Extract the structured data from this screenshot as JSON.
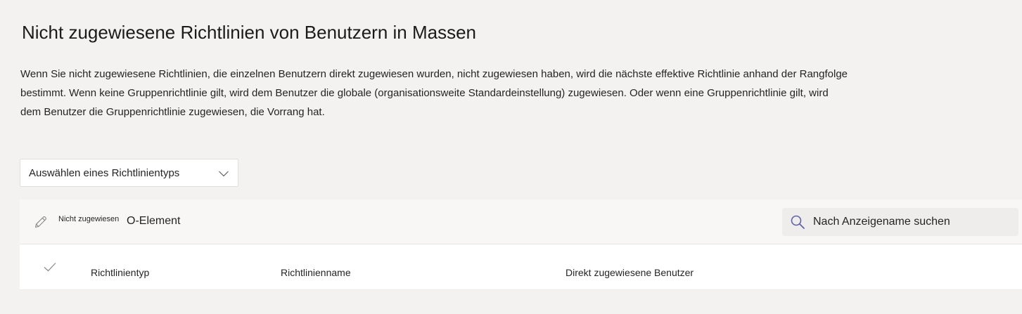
{
  "page": {
    "title": "Nicht zugewiesene Richtlinien von Benutzern in Massen",
    "description": "Wenn Sie nicht zugewiesene Richtlinien, die einzelnen Benutzern direkt zugewiesen wurden, nicht zugewiesen haben, wird die nächste effektive Richtlinie anhand der Rangfolge bestimmt. Wenn keine Gruppenrichtlinie gilt, wird dem Benutzer die globale (organisationsweite Standardeinstellung) zugewiesen. Oder wenn eine Gruppenrichtlinie gilt, wird dem Benutzer die Gruppenrichtlinie zugewiesen, die Vorrang hat."
  },
  "policy_type_dropdown": {
    "label": "Auswählen eines Richtlinientyps",
    "icon": "chevron-down-icon"
  },
  "toolbar": {
    "unassign_label": "Nicht zugewiesen",
    "unassign_suffix": "O-Element",
    "unassign_icon": "pencil-icon",
    "search": {
      "placeholder": "Nach Anzeigename suchen",
      "value": "",
      "icon": "search-icon"
    }
  },
  "table": {
    "select_all_icon": "checkmark-icon",
    "columns": [
      "Richtlinientyp",
      "Richtlinienname",
      "Direkt zugewiesene Benutzer"
    ],
    "rows": []
  },
  "colors": {
    "page_background": "#f3f2f1",
    "panel_background": "#ffffff",
    "toolbar_background": "#f8f7f6",
    "search_background": "#efedeb",
    "search_icon": "#6264a7",
    "text": "#242424"
  }
}
